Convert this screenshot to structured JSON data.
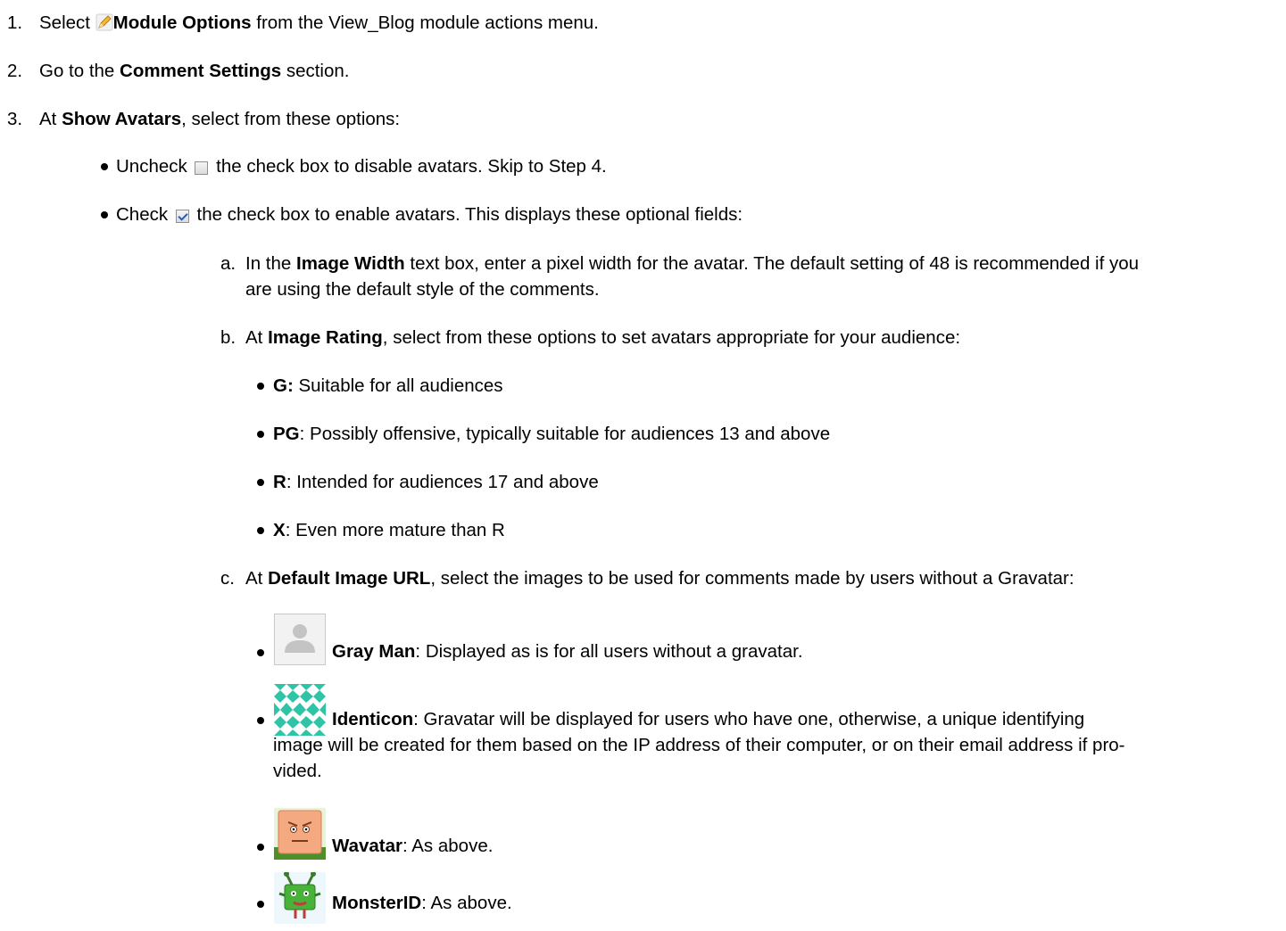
{
  "steps": {
    "s1": {
      "num": "1.",
      "pre": "Select ",
      "bold": "Module Options",
      "post": " from the View_Blog module actions menu."
    },
    "s2": {
      "num": "2.",
      "pre": "Go to the ",
      "bold": "Comment Settings",
      "post": " section."
    },
    "s3": {
      "num": "3.",
      "pre": "At ",
      "bold": "Show Avatars",
      "post": ", select from these options:"
    }
  },
  "options": {
    "uncheck": {
      "pre": "Uncheck ",
      "post": " the check box to disable avatars. Skip to Step 4."
    },
    "check": {
      "pre": "Check ",
      "post": " the check box to enable avatars. This displays these optional fields:"
    }
  },
  "fields": {
    "a": {
      "letter": "a.",
      "pre": "In the ",
      "bold": "Image Width",
      "line1": " text box, enter a pixel width for the avatar. The default setting of 48 is recommended if you",
      "line2": "are using the default style of the comments."
    },
    "b": {
      "letter": "b.",
      "pre": "At ",
      "bold": "Image Rating",
      "post": ", select from these options to set avatars appropriate for your audience:"
    },
    "c": {
      "letter": "c.",
      "pre": "At ",
      "bold": "Default Image URL",
      "post": ", select the images to be used for comments made by users without a Gravatar:"
    }
  },
  "ratings": [
    {
      "label": "G:",
      "text": " Suitable for all audiences"
    },
    {
      "label": "PG",
      "text": ": Possibly offensive, typically suitable for audiences 13 and above"
    },
    {
      "label": "R",
      "text": ": Intended for audiences 17 and above"
    },
    {
      "label": "X",
      "text": ": Even more mature than R"
    }
  ],
  "images": {
    "grayman": {
      "label": "Gray Man",
      "text": ": Displayed as is for all users without a gravatar."
    },
    "identicon": {
      "label": "Identicon",
      "text1": ": Gravatar will be displayed for users who have one, otherwise, a unique identifying",
      "text2": "image will be created for them based on the IP address of their computer, or on their email address if pro-",
      "text3": "vided."
    },
    "wavatar": {
      "label": "Wavatar",
      "text": ": As above."
    },
    "monsterid": {
      "label": "MonsterID",
      "text": ": As above."
    }
  }
}
